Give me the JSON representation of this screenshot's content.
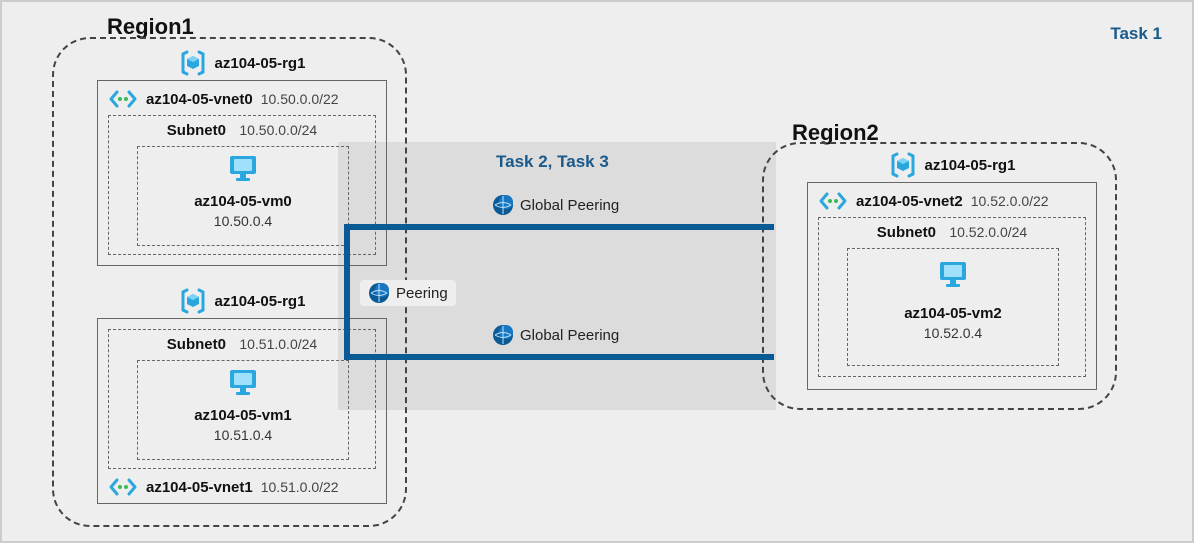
{
  "page": {
    "task1": "Task 1",
    "task23": "Task 2, Task 3"
  },
  "region1": {
    "title": "Region1",
    "rg_a": {
      "name": "az104-05-rg1",
      "vnet": {
        "name": "az104-05-vnet0",
        "cidr": "10.50.0.0/22"
      },
      "subnet": {
        "name": "Subnet0",
        "cidr": "10.50.0.0/24"
      },
      "vm": {
        "name": "az104-05-vm0",
        "ip": "10.50.0.4"
      }
    },
    "rg_b": {
      "name": "az104-05-rg1",
      "vnet": {
        "name": "az104-05-vnet1",
        "cidr": "10.51.0.0/22"
      },
      "subnet": {
        "name": "Subnet0",
        "cidr": "10.51.0.0/24"
      },
      "vm": {
        "name": "az104-05-vm1",
        "ip": "10.51.0.4"
      }
    }
  },
  "region2": {
    "title": "Region2",
    "rg": {
      "name": "az104-05-rg1",
      "vnet": {
        "name": "az104-05-vnet2",
        "cidr": "10.52.0.0/22"
      },
      "subnet": {
        "name": "Subnet0",
        "cidr": "10.52.0.0/24"
      },
      "vm": {
        "name": "az104-05-vm2",
        "ip": "10.52.0.4"
      }
    }
  },
  "peering": {
    "local": "Peering",
    "global_top": "Global Peering",
    "global_bottom": "Global Peering"
  }
}
